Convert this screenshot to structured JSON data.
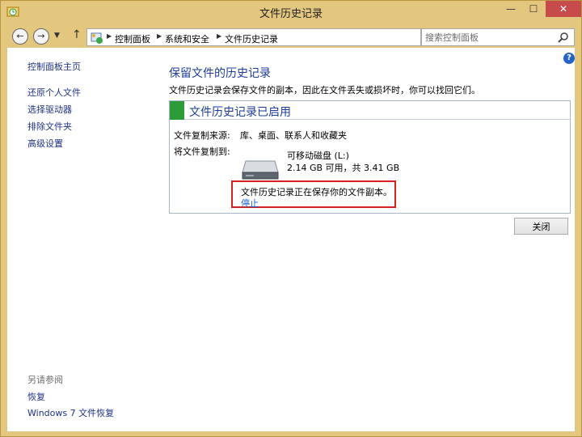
{
  "window": {
    "title": "文件历史记录",
    "minimize": "—",
    "maximize": "☐",
    "close": "✕"
  },
  "address": {
    "crumbs": [
      "控制面板",
      "系统和安全",
      "文件历史记录"
    ],
    "search_placeholder": "搜索控制面板"
  },
  "sidebar": {
    "home": "控制面板主页",
    "items": [
      "还原个人文件",
      "选择驱动器",
      "排除文件夹",
      "高级设置"
    ],
    "see_also_label": "另请参阅",
    "see_also": [
      "恢复",
      "Windows 7 文件恢复"
    ]
  },
  "main": {
    "title": "保留文件的历史记录",
    "description": "文件历史记录会保存文件的副本，因此在文件丢失或损坏时，你可以找回它们。",
    "status": {
      "title": "文件历史记录已启用",
      "source_label": "文件复制来源:",
      "source_value": "库、桌面、联系人和收藏夹",
      "dest_label": "将文件复制到:",
      "drive_name": "可移动磁盘 (L:)",
      "drive_space": "2.14 GB 可用，共 3.41 GB",
      "saving_text": "文件历史记录正在保存你的文件副本。",
      "stop_link": "停止"
    },
    "close_button": "关闭"
  },
  "colors": {
    "frame": "#e3c77f",
    "link": "#1e3287",
    "heading": "#1e3e9a",
    "status_green": "#2b9c39",
    "alert_red": "#d42020"
  }
}
